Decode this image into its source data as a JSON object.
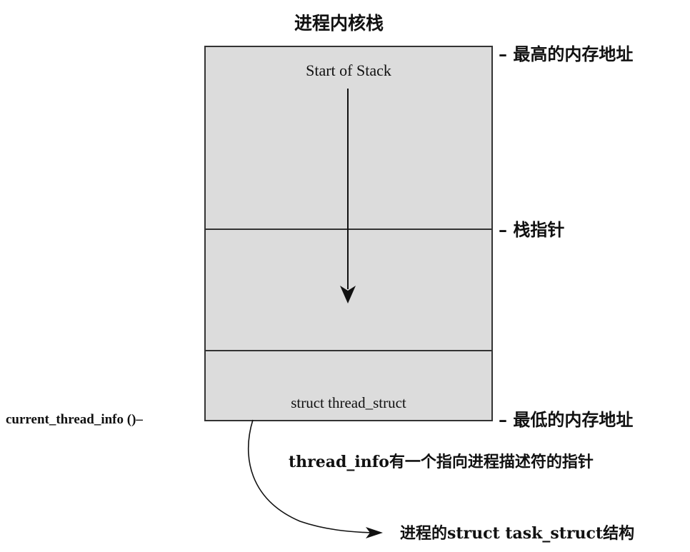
{
  "diagram": {
    "title": "进程内核栈",
    "start_of_stack": "Start of Stack",
    "thread_struct": "struct thread_struct",
    "highest_address": "– 最高的内存地址",
    "stack_pointer": "– 栈指针",
    "lowest_address": "– 最低的内存地址",
    "current_thread_info": "current_thread_info ()–",
    "pointer_note": "thread_info有一个指向进程描述符的指针",
    "task_struct": "进程的struct task_struct结构"
  }
}
